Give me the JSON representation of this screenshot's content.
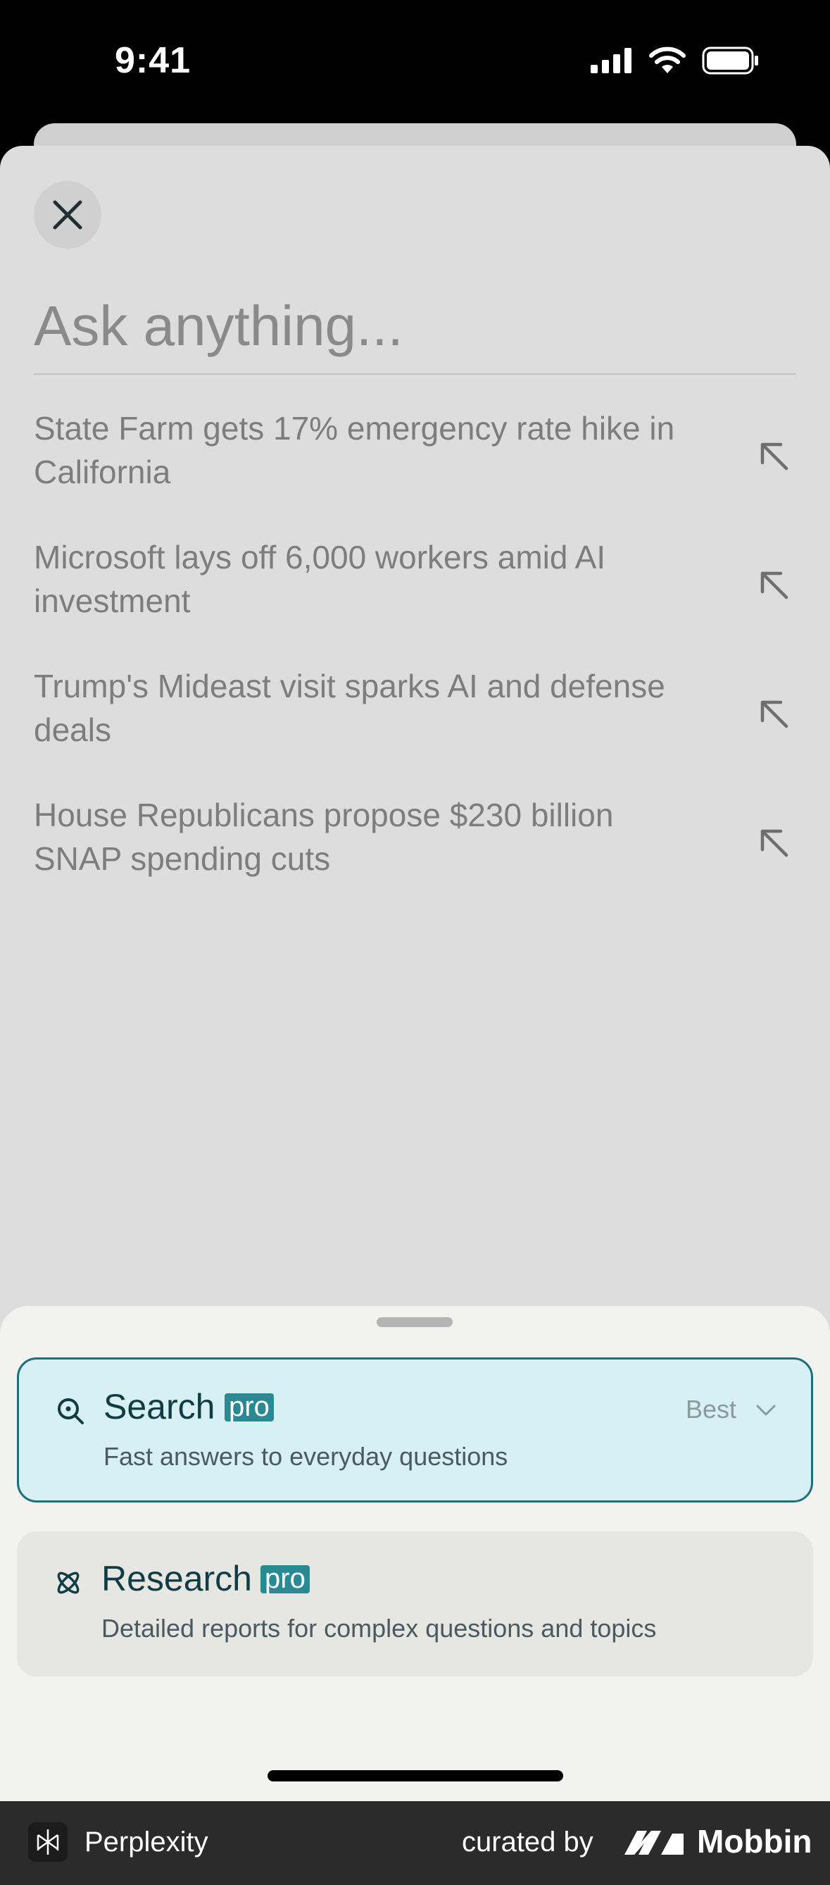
{
  "status_bar": {
    "time": "9:41",
    "icons": [
      "cellular-signal-icon",
      "wifi-icon",
      "battery-icon"
    ]
  },
  "search": {
    "placeholder": "Ask anything...",
    "close_icon": "close-icon"
  },
  "suggestions": [
    {
      "text": "State Farm gets 17% emergency rate hike in California",
      "icon": "arrow-up-left-icon"
    },
    {
      "text": "Microsoft lays off 6,000 workers amid AI investment",
      "icon": "arrow-up-left-icon"
    },
    {
      "text": "Trump's Mideast visit sparks AI and defense deals",
      "icon": "arrow-up-left-icon"
    },
    {
      "text": "House Republicans propose $230 billion SNAP spending cuts",
      "icon": "arrow-up-left-icon"
    }
  ],
  "modes": [
    {
      "title": "Search",
      "badge": "pro",
      "description": "Fast answers to everyday questions",
      "model": "Best",
      "icon": "search-icon",
      "selected": true
    },
    {
      "title": "Research",
      "badge": "pro",
      "description": "Detailed reports for complex questions and topics",
      "icon": "atom-icon",
      "selected": false
    }
  ],
  "footer": {
    "app_name": "Perplexity",
    "curated_by": "curated by",
    "brand": "Mobbin"
  },
  "colors": {
    "accent": "#2a8a93",
    "selected_bg": "#d6f0f3",
    "selected_border": "#1e6f7a",
    "sheet_bg": "#dddddd",
    "panel_bg": "#f2f2ef"
  }
}
